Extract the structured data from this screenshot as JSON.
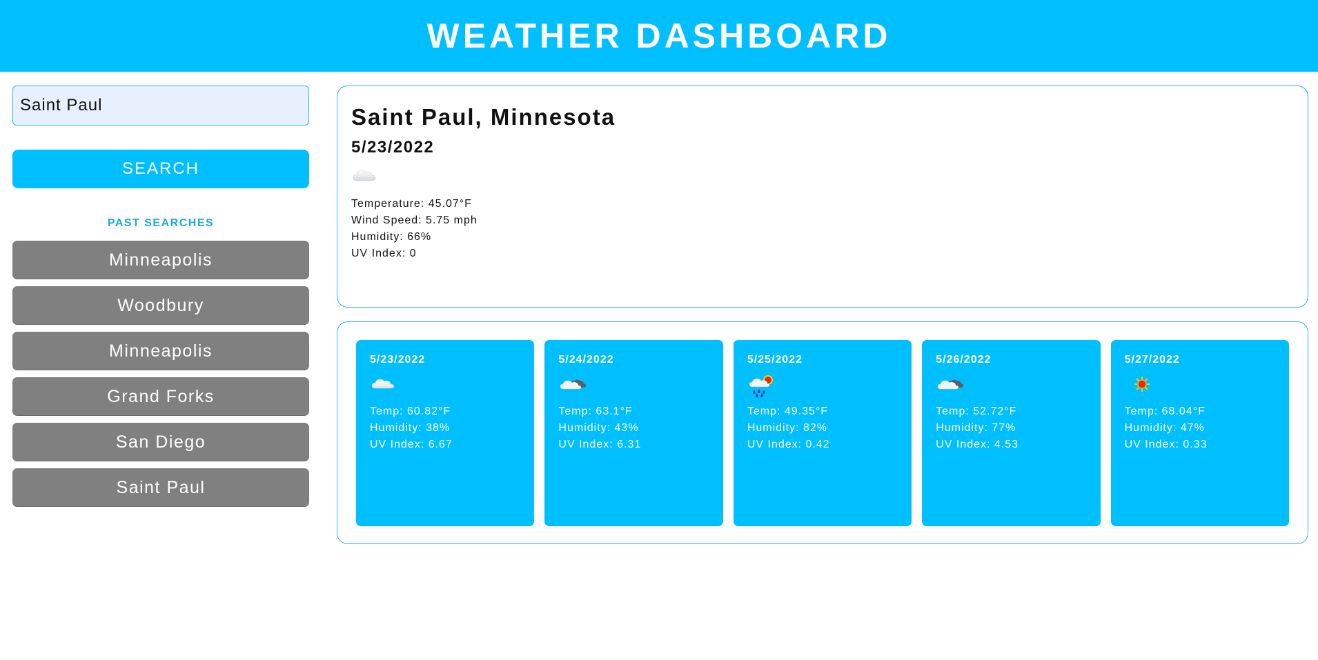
{
  "header": {
    "title": "WEATHER DASHBOARD"
  },
  "search": {
    "value": "Saint Paul",
    "button_label": "SEARCH"
  },
  "past_searches": {
    "title": "PAST SEARCHES",
    "items": [
      {
        "label": "Minneapolis"
      },
      {
        "label": "Woodbury"
      },
      {
        "label": "Minneapolis"
      },
      {
        "label": "Grand Forks"
      },
      {
        "label": "San Diego"
      },
      {
        "label": "Saint Paul"
      }
    ]
  },
  "current": {
    "city": "Saint Paul, Minnesota",
    "date": "5/23/2022",
    "icon": "cloud-icon",
    "temperature": "Temperature: 45.07°F",
    "wind": "Wind Speed: 5.75 mph",
    "humidity": "Humidity: 66%",
    "uv": "UV Index: 0"
  },
  "forecast": [
    {
      "date": "5/23/2022",
      "icon": "few-clouds-icon",
      "temp": "Temp: 60.82°F",
      "humidity": "Humidity: 38%",
      "uv": "UV Index: 6.67"
    },
    {
      "date": "5/24/2022",
      "icon": "broken-clouds-icon",
      "temp": "Temp: 63.1°F",
      "humidity": "Humidity: 43%",
      "uv": "UV Index: 6.31"
    },
    {
      "date": "5/25/2022",
      "icon": "rain-sun-icon",
      "temp": "Temp: 49.35°F",
      "humidity": "Humidity: 82%",
      "uv": "UV Index: 0.42"
    },
    {
      "date": "5/26/2022",
      "icon": "broken-clouds-icon",
      "temp": "Temp: 52.72°F",
      "humidity": "Humidity: 77%",
      "uv": "UV Index: 4.53"
    },
    {
      "date": "5/27/2022",
      "icon": "sun-icon",
      "temp": "Temp: 68.04°F",
      "humidity": "Humidity: 47%",
      "uv": "UV Index: 0.33"
    }
  ],
  "colors": {
    "accent": "#00bfff",
    "past_button": "#808080",
    "border": "#27b7e8",
    "input_bg": "#e8f0fe"
  }
}
